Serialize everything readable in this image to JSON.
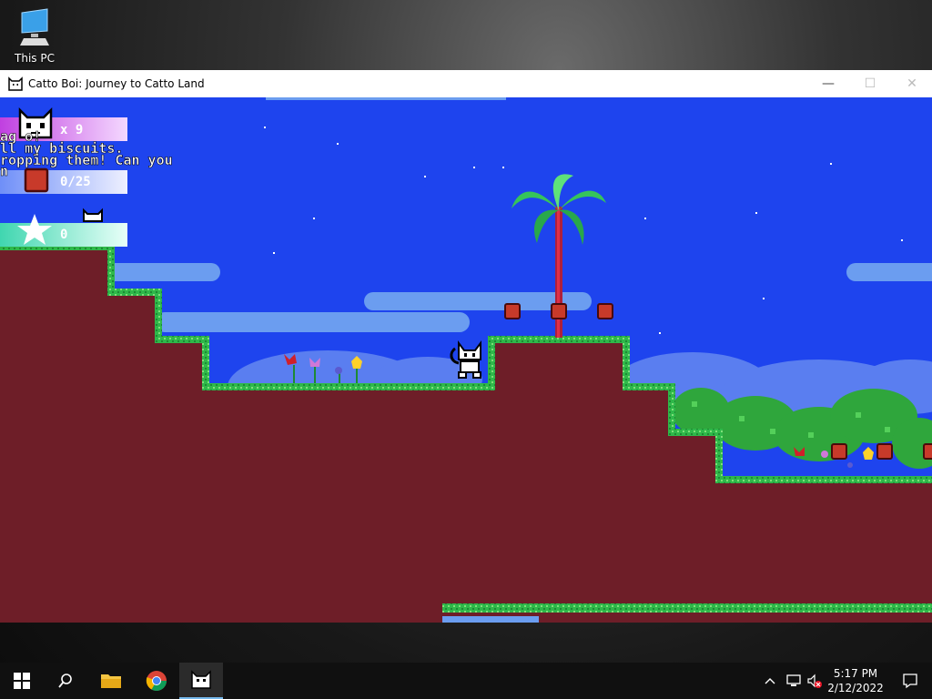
{
  "desktop": {
    "icon_label": "This PC"
  },
  "window": {
    "title": "Catto Boi: Journey to Catto Land",
    "minimize_glyph": "—",
    "maximize_glyph": "☐",
    "close_glyph": "✕"
  },
  "hud": {
    "lives": "x 9",
    "biscuits": "0/25",
    "stars": "0"
  },
  "dialog": {
    "line1": "ag        o!",
    "line2": "ll my biscuits.",
    "line3": "ropping them! Can you",
    "line4": "n"
  },
  "taskbar": {
    "time": "5:17 PM",
    "date": "2/12/2022"
  },
  "colors": {
    "sky": "#1e44ee",
    "ground": "#6e1e28",
    "grass": "#2fb84a",
    "cloud": "#6b9df0"
  }
}
